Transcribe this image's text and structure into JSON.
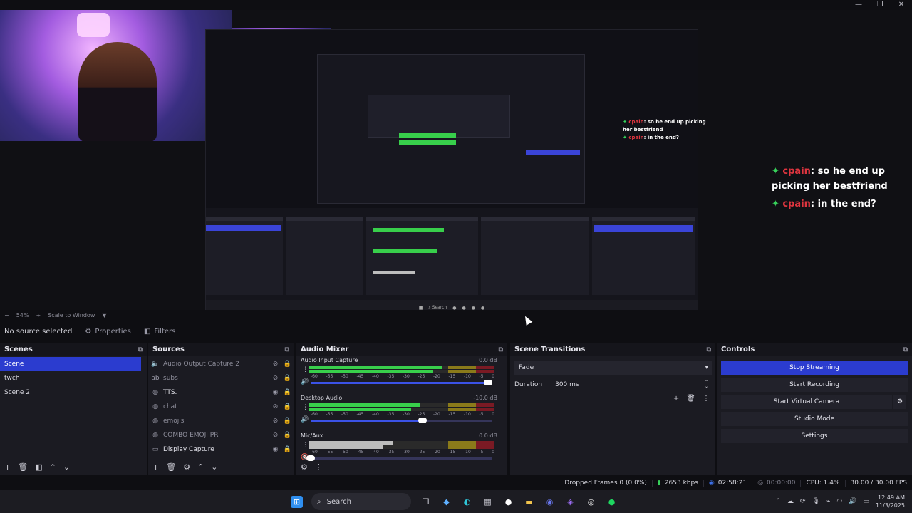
{
  "window": {
    "controls": [
      "minimize",
      "maximize",
      "close"
    ]
  },
  "preview": {
    "chat_overlay": {
      "lines": [
        {
          "user": "cpain",
          "text": ": so he end up picking her bestfriend"
        },
        {
          "user": "cpain",
          "text": ": in the end?"
        }
      ]
    }
  },
  "zoom": {
    "level": "54%",
    "mode": "Scale to Window"
  },
  "context": {
    "source_label": "No source selected",
    "properties_label": "Properties",
    "filters_label": "Filters"
  },
  "scenes": {
    "title": "Scenes",
    "items": [
      {
        "label": "Scene",
        "active": true
      },
      {
        "label": "twch",
        "active": false
      },
      {
        "label": "Scene 2",
        "active": false
      }
    ]
  },
  "sources": {
    "title": "Sources",
    "items": [
      {
        "label": "Audio Output Capture 2",
        "icon": "speaker-icon",
        "visible": false
      },
      {
        "label": "subs",
        "icon": "text-icon",
        "visible": false
      },
      {
        "label": "TTS.",
        "icon": "browser-icon",
        "visible": true
      },
      {
        "label": "chat",
        "icon": "browser-icon",
        "visible": false
      },
      {
        "label": "emojis",
        "icon": "browser-icon",
        "visible": false
      },
      {
        "label": "COMBO EMOJI PR",
        "icon": "browser-icon",
        "visible": false
      },
      {
        "label": "Display Capture",
        "icon": "monitor-icon",
        "visible": true
      }
    ]
  },
  "mixer": {
    "title": "Audio Mixer",
    "ticks": [
      "-60",
      "-55",
      "-50",
      "-45",
      "-40",
      "-35",
      "-30",
      "-25",
      "-20",
      "-15",
      "-10",
      "-5",
      "0"
    ],
    "channels": [
      {
        "name": "Audio Input Capture",
        "db": "0.0 dB",
        "level": 0.72,
        "volume": 0.98,
        "muted": false
      },
      {
        "name": "Desktop Audio",
        "db": "-10.0 dB",
        "level": 0.6,
        "volume": 0.62,
        "muted": false
      },
      {
        "name": "Mic/Aux",
        "db": "0.0 dB",
        "level": 0.45,
        "volume": 0.0,
        "muted": true
      }
    ]
  },
  "transitions": {
    "title": "Scene Transitions",
    "selected": "Fade",
    "duration_label": "Duration",
    "duration_value": "300 ms"
  },
  "controls": {
    "title": "Controls",
    "buttons": [
      {
        "label": "Stop Streaming",
        "primary": true
      },
      {
        "label": "Start Recording",
        "primary": false
      },
      {
        "label": "Start Virtual Camera",
        "primary": false
      },
      {
        "label": "Studio Mode",
        "primary": false
      },
      {
        "label": "Settings",
        "primary": false
      }
    ]
  },
  "status": {
    "dropped_frames": "Dropped Frames 0 (0.0%)",
    "bitrate": "2653 kbps",
    "stream_time": "02:58:21",
    "record_time": "00:00:00",
    "cpu": "CPU: 1.4%",
    "fps": "30.00 / 30.00 FPS"
  },
  "taskbar": {
    "search_label": "Search",
    "time": "12:49 AM",
    "date": "11/3/2025"
  },
  "colors": {
    "accent": "#2b3ccf",
    "meter_green": "#38cf4b",
    "stream_indicator": "#37d05a"
  }
}
